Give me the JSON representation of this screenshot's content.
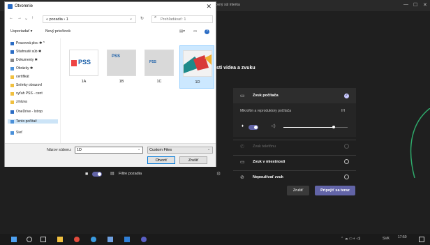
{
  "teams": {
    "title": "ovný súl interka",
    "heading": "sti videa a zvuku",
    "preview": {
      "filter_label": "Filtre pozadia"
    },
    "audio": {
      "computer_audio": "Zvuk počítača",
      "devices_label": "Mikrofón a reproduktory počítača",
      "devices_value": "IH",
      "phone_audio": "Zvuk telefónu",
      "room_audio": "Zvuk v miestnosti",
      "no_audio": "Nepoužívať zvuk",
      "volume_level": 0.78
    },
    "buttons": {
      "cancel": "Zrušiť",
      "join": "Pripojiť sa teraz"
    },
    "accent_color": "#6264a7"
  },
  "dialog": {
    "title": "Otvorenie",
    "address": "« pozadia › 1",
    "search_placeholder": "Prehľadávať: 1",
    "toolbar": {
      "organize": "Usporiadať ▾",
      "new_folder": "Nový priečinok"
    },
    "nav_items": [
      {
        "label": "Pracovná ploc ✱ ^",
        "icon": "desktop-icon"
      },
      {
        "label": "Stiahnuté súb ✱",
        "icon": "download-icon"
      },
      {
        "label": "Dokumenty ✱",
        "icon": "documents-icon"
      },
      {
        "label": "Obrázky ✱",
        "icon": "pictures-icon"
      },
      {
        "label": "certifikát",
        "icon": "folder-icon"
      },
      {
        "label": "Snímky obrazovl",
        "icon": "folder-icon"
      },
      {
        "label": "vyťah PSS - cent",
        "icon": "folder-icon"
      },
      {
        "label": "zmluva",
        "icon": "folder-icon"
      },
      {
        "label": "OneDrive - Istrop",
        "icon": "onedrive-icon"
      },
      {
        "label": "Tento počítač",
        "icon": "computer-icon"
      },
      {
        "label": "Sieť",
        "icon": "network-icon"
      }
    ],
    "files": [
      {
        "label": "1A",
        "brand": "PSS"
      },
      {
        "label": "1B",
        "brand": "PSS"
      },
      {
        "label": "1C",
        "brand": "PSS"
      },
      {
        "label": "1D",
        "brand": ""
      }
    ],
    "filename_label": "Názov súboru:",
    "filename_value": "1D",
    "filetype_value": "Custom Files",
    "open_button": "Otvoriť",
    "cancel_button": "Zrušiť"
  },
  "taskbar": {
    "clock": "17:50",
    "lang": "SVK"
  }
}
